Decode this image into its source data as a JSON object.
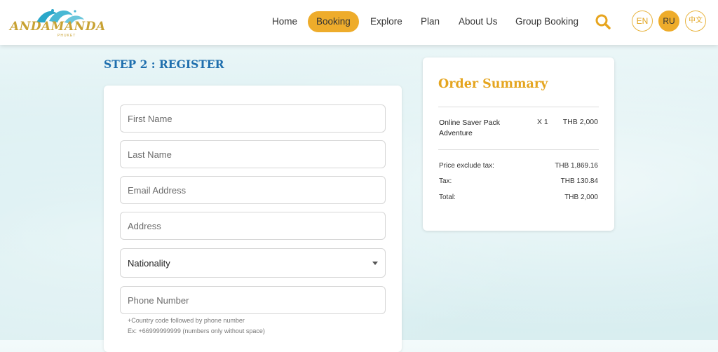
{
  "header": {
    "logo_text": "ANDAMANDA",
    "logo_sub": "PHUKET",
    "nav": [
      {
        "label": "Home",
        "active": false
      },
      {
        "label": "Booking",
        "active": true
      },
      {
        "label": "Explore",
        "active": false
      },
      {
        "label": "Plan",
        "active": false
      },
      {
        "label": "About Us",
        "active": false
      },
      {
        "label": "Group Booking",
        "active": false
      }
    ],
    "languages": [
      {
        "label": "EN",
        "active": false
      },
      {
        "label": "RU",
        "active": true
      },
      {
        "label": "中文",
        "active": false
      }
    ],
    "search_icon": "search-icon"
  },
  "step_title": "STEP 2 : REGISTER",
  "form": {
    "first_name_placeholder": "First Name",
    "last_name_placeholder": "Last Name",
    "email_placeholder": "Email Address",
    "address_placeholder": "Address",
    "nationality_label": "Nationality",
    "phone_placeholder": "Phone Number",
    "phone_hint_1": "+Country code followed by phone number",
    "phone_hint_2": "Ex: +66999999999 (numbers only without space)"
  },
  "summary": {
    "title": "Order Summary",
    "item_name": "Online Saver Pack Adventure",
    "item_qty": "X 1",
    "item_price": "THB 2,000",
    "rows": [
      {
        "label": "Price exclude tax:",
        "value": "THB 1,869.16"
      },
      {
        "label": "Tax:",
        "value": "THB 130.84"
      },
      {
        "label": "Total:",
        "value": "THB 2,000"
      }
    ]
  },
  "colors": {
    "accent": "#eeac2b",
    "title_blue": "#1f6fae",
    "summary_title": "#e5a51f"
  }
}
